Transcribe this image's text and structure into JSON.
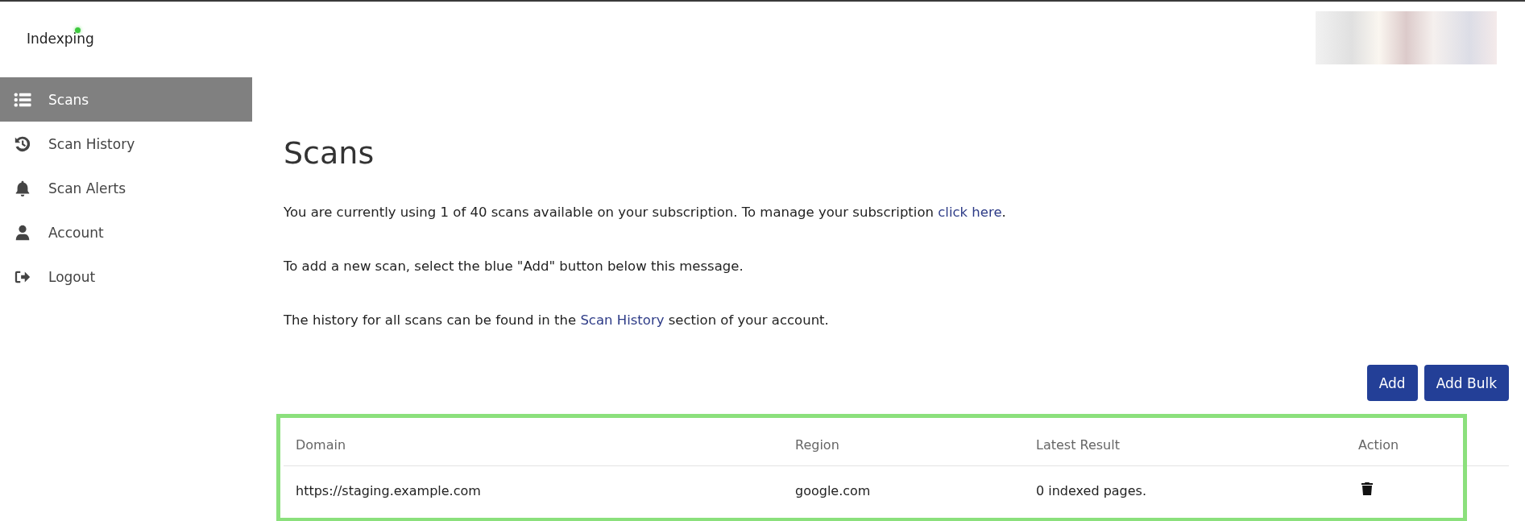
{
  "brand": {
    "name": "Indexping"
  },
  "sidebar": {
    "items": [
      {
        "label": "Scans",
        "kind": "list",
        "selected": true
      },
      {
        "label": "Scan History",
        "kind": "history",
        "selected": false
      },
      {
        "label": "Scan Alerts",
        "kind": "bell",
        "selected": false
      },
      {
        "label": "Account",
        "kind": "user",
        "selected": false
      },
      {
        "label": "Logout",
        "kind": "logout",
        "selected": false
      }
    ]
  },
  "page": {
    "title": "Scans",
    "messages": [
      {
        "before": "You are currently using 1 of 40 scans available on your subscription. To manage your subscription ",
        "link": "click here",
        "after": "."
      },
      {
        "before": "To add a new scan, select the blue \"Add\" button below this message."
      },
      {
        "before": "The history for all scans can be found in the ",
        "link": "Scan History",
        "after": " section of your account."
      }
    ],
    "buttons": [
      "Add",
      "Add Bulk"
    ]
  },
  "table": {
    "highlighted": true,
    "columns": [
      "Domain",
      "Region",
      "Latest Result",
      "Action"
    ],
    "rows": [
      {
        "domain": "https://staging.example.com",
        "region": "google.com",
        "latest_result": "0 indexed pages."
      }
    ]
  }
}
